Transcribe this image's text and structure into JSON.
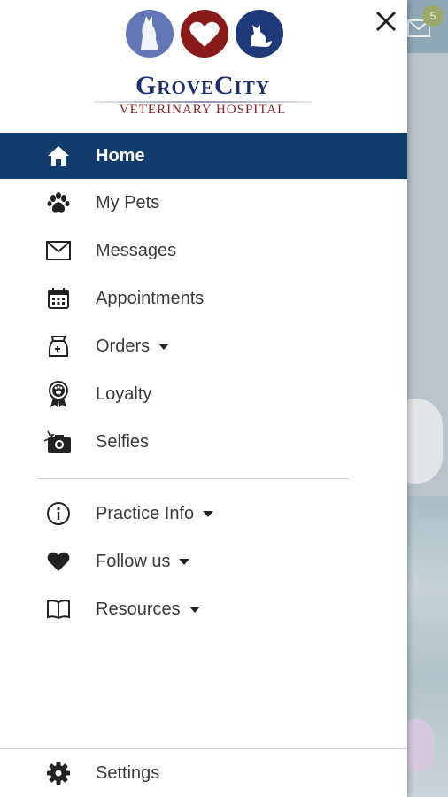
{
  "brand": {
    "name": "GroveCity",
    "subtitle": "VETERINARY HOSPITAL",
    "colors": {
      "navy": "#1f2f6f",
      "red": "#8b1c1c",
      "circle_blue": "#6276b8",
      "circle_red": "#8a1a1a",
      "circle_navy": "#1f3a7a"
    }
  },
  "drawer": {
    "close_icon": "close-icon",
    "main_items": [
      {
        "label": "Home",
        "icon": "home-icon",
        "active": true,
        "has_caret": false
      },
      {
        "label": "My Pets",
        "icon": "paw-icon",
        "active": false,
        "has_caret": false
      },
      {
        "label": "Messages",
        "icon": "mail-icon",
        "active": false,
        "has_caret": false
      },
      {
        "label": "Appointments",
        "icon": "calendar-icon",
        "active": false,
        "has_caret": false
      },
      {
        "label": "Orders",
        "icon": "pet-food-bag-icon",
        "active": false,
        "has_caret": true
      },
      {
        "label": "Loyalty",
        "icon": "ribbon-paw-icon",
        "active": false,
        "has_caret": false
      },
      {
        "label": "Selfies",
        "icon": "camera-icon",
        "active": false,
        "has_caret": false
      }
    ],
    "secondary_items": [
      {
        "label": "Practice Info",
        "icon": "info-icon",
        "has_caret": true
      },
      {
        "label": "Follow us",
        "icon": "heart-icon",
        "has_caret": true
      },
      {
        "label": "Resources",
        "icon": "book-icon",
        "has_caret": true
      }
    ],
    "footer_item": {
      "label": "Settings",
      "icon": "gear-icon"
    }
  },
  "background": {
    "mail_badge_count": "5",
    "accent": "#123c6b"
  }
}
